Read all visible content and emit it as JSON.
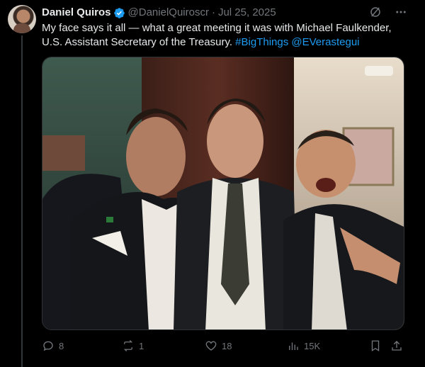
{
  "author": {
    "display_name": "Daniel Quiros",
    "handle": "@DanielQuiroscr",
    "separator": "·",
    "date": "Jul 25, 2025",
    "verified_color": "#1d9bf0"
  },
  "tweet": {
    "text_part1": "My face says it all — what a great meeting it was with Michael Faulkender, U.S. Assistant Secretary of the Treasury. ",
    "hashtag": "#BigThings",
    "mention": "@EVerastegui"
  },
  "header_icons": [
    "grok-icon",
    "more-icon"
  ],
  "actions": {
    "replies": "8",
    "reposts": "1",
    "likes": "18",
    "views": "15K"
  },
  "colors": {
    "background": "#000000",
    "text": "#e7e9ea",
    "muted": "#71767b",
    "link": "#1d9bf0"
  }
}
